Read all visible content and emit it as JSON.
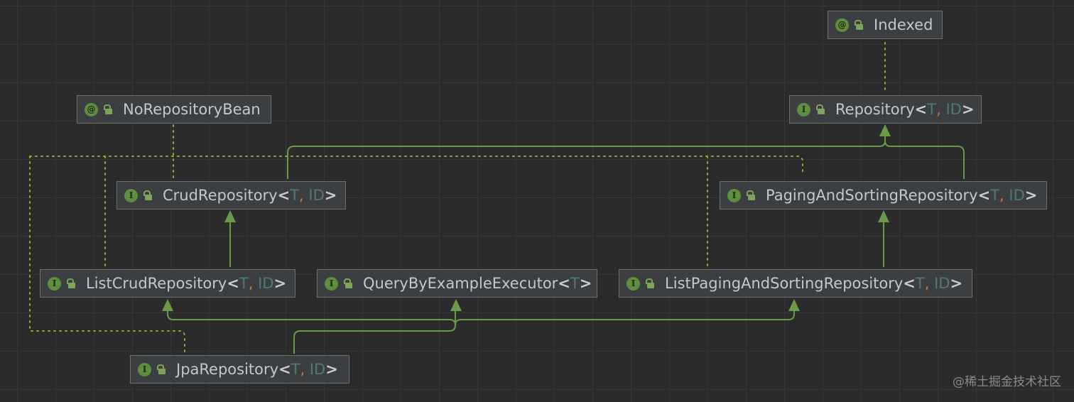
{
  "colors": {
    "background": "#2b2b2b",
    "node_fill": "#3c3f41",
    "node_border": "#6d6d6d",
    "extends_edge": "#6a9a48",
    "annotation_edge": "#a3a31f",
    "badge": "#5e8e3e",
    "type_param": "#507874",
    "comma": "#cc7832"
  },
  "nodes": {
    "indexed": {
      "kind": "annotation",
      "badge": "@",
      "name": "Indexed",
      "params": []
    },
    "no_repository_bean": {
      "kind": "annotation",
      "badge": "@",
      "name": "NoRepositoryBean",
      "params": []
    },
    "repository": {
      "kind": "interface",
      "badge": "I",
      "name": "Repository",
      "params": [
        "T",
        "ID"
      ]
    },
    "crud_repository": {
      "kind": "interface",
      "badge": "I",
      "name": "CrudRepository",
      "params": [
        "T",
        "ID"
      ]
    },
    "paging_and_sorting_repository": {
      "kind": "interface",
      "badge": "I",
      "name": "PagingAndSortingRepository",
      "params": [
        "T",
        "ID"
      ]
    },
    "list_crud_repository": {
      "kind": "interface",
      "badge": "I",
      "name": "ListCrudRepository",
      "params": [
        "T",
        "ID"
      ]
    },
    "query_by_example_executor": {
      "kind": "interface",
      "badge": "I",
      "name": "QueryByExampleExecutor",
      "params": [
        "T"
      ]
    },
    "list_paging_and_sorting_repository": {
      "kind": "interface",
      "badge": "I",
      "name": "ListPagingAndSortingRepository",
      "params": [
        "T",
        "ID"
      ]
    },
    "jpa_repository": {
      "kind": "interface",
      "badge": "I",
      "name": "JpaRepository",
      "params": [
        "T",
        "ID"
      ]
    }
  },
  "edges": [
    {
      "from": "repository",
      "to": "indexed",
      "type": "annotated"
    },
    {
      "from": "crud_repository",
      "to": "repository",
      "type": "extends"
    },
    {
      "from": "paging_and_sorting_repository",
      "to": "repository",
      "type": "extends"
    },
    {
      "from": "list_crud_repository",
      "to": "crud_repository",
      "type": "extends"
    },
    {
      "from": "list_paging_and_sorting_repository",
      "to": "paging_and_sorting_repository",
      "type": "extends"
    },
    {
      "from": "jpa_repository",
      "to": "list_crud_repository",
      "type": "extends"
    },
    {
      "from": "jpa_repository",
      "to": "query_by_example_executor",
      "type": "extends"
    },
    {
      "from": "jpa_repository",
      "to": "list_paging_and_sorting_repository",
      "type": "extends"
    },
    {
      "from": "crud_repository",
      "to": "no_repository_bean",
      "type": "annotated"
    },
    {
      "from": "list_crud_repository",
      "to": "no_repository_bean",
      "type": "annotated"
    },
    {
      "from": "jpa_repository",
      "to": "no_repository_bean",
      "type": "annotated"
    },
    {
      "from": "paging_and_sorting_repository",
      "to": "no_repository_bean",
      "type": "annotated"
    },
    {
      "from": "list_paging_and_sorting_repository",
      "to": "no_repository_bean",
      "type": "annotated"
    }
  ],
  "watermark": "@稀土掘金技术社区"
}
